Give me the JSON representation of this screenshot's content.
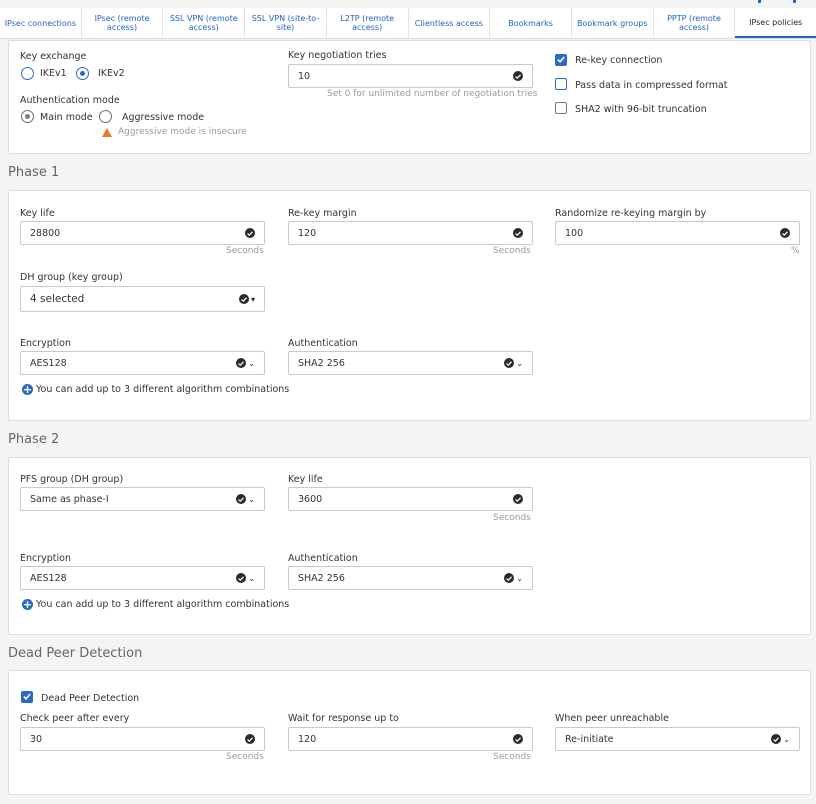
{
  "tabs": [
    {
      "label": "IPsec connections"
    },
    {
      "label": "IPsec (remote access)"
    },
    {
      "label": "SSL VPN (remote access)"
    },
    {
      "label": "SSL VPN (site-to-site)"
    },
    {
      "label": "L2TP (remote access)"
    },
    {
      "label": "Clientless access"
    },
    {
      "label": "Bookmarks"
    },
    {
      "label": "Bookmark groups"
    },
    {
      "label": "PPTP (remote access)"
    },
    {
      "label": "IPsec policies"
    }
  ],
  "general": {
    "key_exchange_label": "Key exchange",
    "ikev1": "IKEv1",
    "ikev2": "IKEv2",
    "auth_mode_label": "Authentication mode",
    "main_mode": "Main mode",
    "aggressive_mode": "Aggressive mode",
    "aggressive_warning": "Aggressive mode is insecure",
    "negotiation_label": "Key negotiation tries",
    "negotiation_value": "10",
    "negotiation_hint": "Set 0 for unlimited number of negotiation tries",
    "rekey": "Re-key connection",
    "compress": "Pass data in compressed format",
    "sha2_trunc": "SHA2 with 96-bit truncation"
  },
  "phase1": {
    "title": "Phase 1",
    "key_life_label": "Key life",
    "key_life_value": "28800",
    "seconds": "Seconds",
    "rekey_margin_label": "Re-key margin",
    "rekey_margin_value": "120",
    "randomize_label": "Randomize re-keying margin by",
    "randomize_value": "100",
    "percent": "%",
    "dh_label": "DH group (key group)",
    "dh_value": "4 selected",
    "enc_label": "Encryption",
    "enc_value": "AES128",
    "auth_label": "Authentication",
    "auth_value": "SHA2 256",
    "add_combo": "You can add up to 3 different algorithm combinations"
  },
  "phase2": {
    "title": "Phase 2",
    "pfs_label": "PFS group (DH group)",
    "pfs_value": "Same as phase-I",
    "key_life_label": "Key life",
    "key_life_value": "3600",
    "seconds": "Seconds",
    "enc_label": "Encryption",
    "enc_value": "AES128",
    "auth_label": "Authentication",
    "auth_value": "SHA2 256",
    "add_combo": "You can add up to 3 different algorithm combinations"
  },
  "dpd": {
    "title": "Dead Peer Detection",
    "enable": "Dead Peer Detection",
    "check_label": "Check peer after every",
    "check_value": "30",
    "wait_label": "Wait for response up to",
    "wait_value": "120",
    "seconds": "Seconds",
    "unreach_label": "When peer unreachable",
    "unreach_value": "Re-initiate"
  }
}
